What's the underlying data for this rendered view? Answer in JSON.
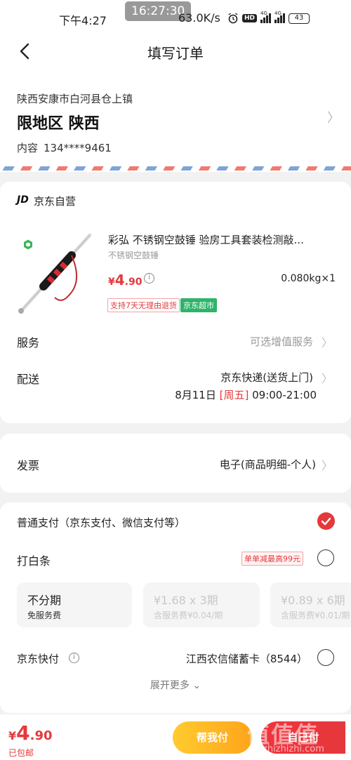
{
  "status_bar": {
    "time": "下午4:27",
    "timer": "16:27:30",
    "net_speed": "63.0K/s",
    "hd": "HD",
    "sig1": "4G",
    "sig2": "4G",
    "battery": "43"
  },
  "header": {
    "title": "填写订单"
  },
  "address": {
    "region": "陕西安康市白河县仓上镇",
    "detail": "限地区 陕西",
    "contact_label": "内容",
    "phone": "134****9461"
  },
  "store": {
    "logo": "JD",
    "name": "京东自营",
    "product": {
      "title": "彩弘 不锈钢空鼓锤 验房工具套装检测敲...",
      "spec": "不锈钢空鼓锤",
      "price_currency": "¥",
      "price_int": "4",
      "price_dec": ".90",
      "weight": "0.080kg×1",
      "tag_return": "支持7天无理由退货",
      "tag_super": "京东超市"
    },
    "service": {
      "label": "服务",
      "value": "可选增值服务"
    },
    "delivery": {
      "label": "配送",
      "value": "京东快递(送货上门)",
      "date": "8月11日",
      "weekday": "[周五]",
      "time_range": "09:00-21:00"
    }
  },
  "invoice": {
    "label": "发票",
    "value": "电子(商品明细-个人)"
  },
  "payment": {
    "normal": "普通支付（京东支付、微信支付等）",
    "baitiao": "打白条",
    "promo": "单单减最高99元",
    "plans": [
      {
        "title": "不分期",
        "sub": "免服务费"
      },
      {
        "title": "¥1.68 x 3期",
        "sub": "含服务费¥0.04/期"
      },
      {
        "title": "¥0.89 x 6期",
        "sub": "含服务费¥0.01/期"
      }
    ],
    "quickpay": "京东快付",
    "card": "江西农信储蓄卡（8544）",
    "expand": "展开更多"
  },
  "bottom": {
    "currency": "¥",
    "total_int": "4",
    "total_dec": ".90",
    "shipping": "已包邮",
    "help_pay": "帮我付",
    "self_pay": "自己付"
  },
  "watermark": {
    "main": "值值值",
    "sub": "zhizhizhi.com"
  },
  "colors": {
    "accent": "#e4393c",
    "yellow": "#ffb21e",
    "green": "#2fb36a"
  }
}
